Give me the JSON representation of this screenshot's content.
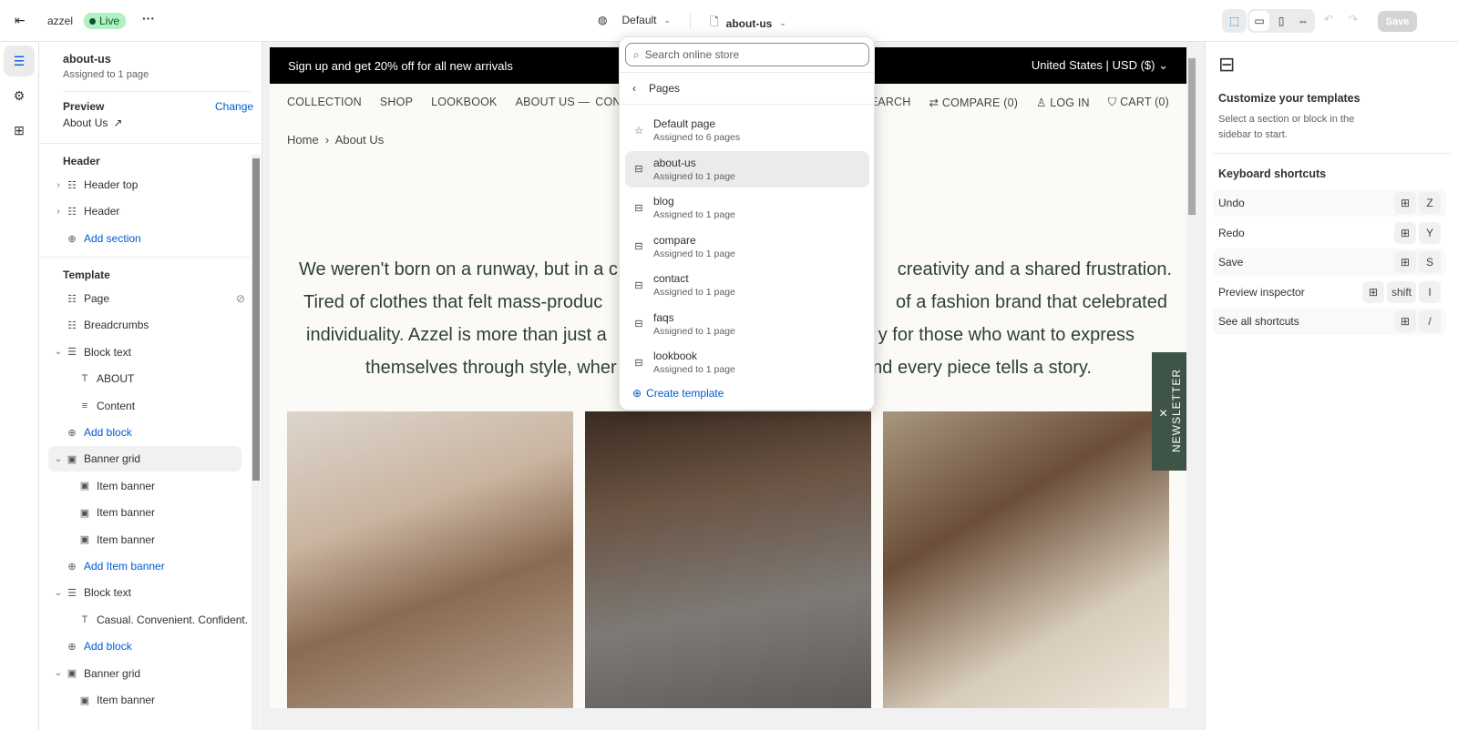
{
  "topbar": {
    "store": "azzel",
    "status": "Live",
    "theme": "Default",
    "template": "about-us",
    "save": "Save"
  },
  "left": {
    "template_name": "about-us",
    "assigned": "Assigned to 1 page",
    "preview_label": "Preview",
    "change": "Change",
    "preview_page": "About Us",
    "header_group": "Header",
    "header_items": [
      "Header top",
      "Header"
    ],
    "add_section": "Add section",
    "template_group": "Template",
    "tree": [
      {
        "label": "Page",
        "level": 0,
        "chev": false,
        "icon": "section-icon"
      },
      {
        "label": "Breadcrumbs",
        "level": 0,
        "chev": false,
        "icon": "section-icon"
      },
      {
        "label": "Block text",
        "level": 0,
        "chev": true,
        "icon": "text-block-icon"
      },
      {
        "label": "ABOUT",
        "level": 1,
        "icon": "type-icon"
      },
      {
        "label": "Content",
        "level": 1,
        "icon": "paragraph-icon"
      },
      {
        "label": "Add block",
        "level": 1,
        "add": true
      },
      {
        "label": "Banner grid",
        "level": 0,
        "chev": true,
        "icon": "image-icon",
        "hl": true
      },
      {
        "label": "Item banner",
        "level": 1,
        "icon": "image-icon"
      },
      {
        "label": "Item banner",
        "level": 1,
        "icon": "image-icon"
      },
      {
        "label": "Item banner",
        "level": 1,
        "icon": "image-icon"
      },
      {
        "label": "Add Item banner",
        "level": 1,
        "add": true
      },
      {
        "label": "Block text",
        "level": 0,
        "chev": true,
        "icon": "text-block-icon"
      },
      {
        "label": "Casual. Convenient. Confident.",
        "level": 1,
        "icon": "type-icon"
      },
      {
        "label": "Add block",
        "level": 1,
        "add": true
      },
      {
        "label": "Banner grid",
        "level": 0,
        "chev": true,
        "icon": "image-icon"
      },
      {
        "label": "Item banner",
        "level": 1,
        "icon": "image-icon"
      }
    ]
  },
  "store": {
    "announcement": "Sign up and get 20% off for all new arrivals",
    "locale": "United States | USD ($)",
    "nav_left": [
      "COLLECTION",
      "SHOP",
      "LOOKBOOK",
      "ABOUT US",
      "CONTACT US"
    ],
    "nav_right": [
      "SEARCH",
      "COMPARE (0)",
      "LOG IN",
      "CART (0)"
    ],
    "breadcrumb": [
      "Home",
      "About Us"
    ],
    "paragraph": [
      [
        "We weren't born on a runway, but in a c",
        "creativity and a shared frustration."
      ],
      [
        "Tired of clothes that felt mass-produc",
        "of a fashion brand that celebrated"
      ],
      [
        "individuality. Azzel is more than just a",
        "y for those who want to express"
      ],
      [
        "themselves through style, wher",
        "nd every piece tells a story."
      ]
    ],
    "newsletter": "NEWSLETTER"
  },
  "dropdown": {
    "search_placeholder": "Search online store",
    "back_label": "Pages",
    "items": [
      {
        "title": "Default page",
        "sub": "Assigned to 6 pages",
        "icon": "star-icon"
      },
      {
        "title": "about-us",
        "sub": "Assigned to 1 page",
        "icon": "template-icon",
        "selected": true
      },
      {
        "title": "blog",
        "sub": "Assigned to 1 page",
        "icon": "template-icon"
      },
      {
        "title": "compare",
        "sub": "Assigned to 1 page",
        "icon": "template-icon"
      },
      {
        "title": "contact",
        "sub": "Assigned to 1 page",
        "icon": "template-icon"
      },
      {
        "title": "faqs",
        "sub": "Assigned to 1 page",
        "icon": "template-icon"
      },
      {
        "title": "lookbook",
        "sub": "Assigned to 1 page",
        "icon": "template-icon"
      }
    ],
    "create": "Create template"
  },
  "right": {
    "title": "Customize your templates",
    "desc": "Select a section or block in the sidebar to start.",
    "shortcuts_title": "Keyboard shortcuts",
    "shortcuts": [
      {
        "label": "Undo",
        "keys": [
          "⊞",
          "Z"
        ]
      },
      {
        "label": "Redo",
        "keys": [
          "⊞",
          "Y"
        ]
      },
      {
        "label": "Save",
        "keys": [
          "⊞",
          "S"
        ]
      },
      {
        "label": "Preview inspector",
        "keys": [
          "⊞",
          "shift",
          "I"
        ]
      },
      {
        "label": "See all shortcuts",
        "keys": [
          "⊞",
          "/"
        ]
      }
    ]
  },
  "colors": {
    "accent": "#005bd3",
    "live": "#aff3c0",
    "newsletter": "#3d5447"
  }
}
